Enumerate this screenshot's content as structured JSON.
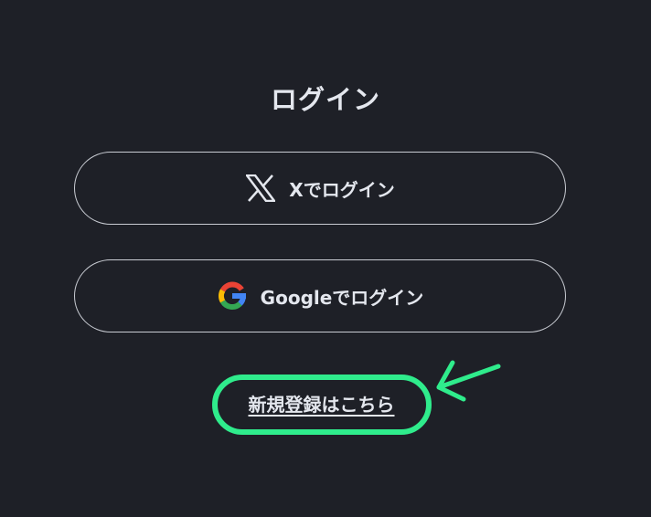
{
  "page": {
    "title": "ログイン"
  },
  "buttons": {
    "x_login_label": "Xでログイン",
    "google_login_label": "Googleでログイン"
  },
  "links": {
    "register_label": "新規登録はこちら"
  },
  "icons": {
    "x": "x-logo-icon",
    "google": "google-logo-icon",
    "arrow": "arrow-icon"
  },
  "colors": {
    "background": "#1e2027",
    "text": "#e4e7ee",
    "border": "#c9ccd3",
    "annotation": "#2fec8c"
  }
}
